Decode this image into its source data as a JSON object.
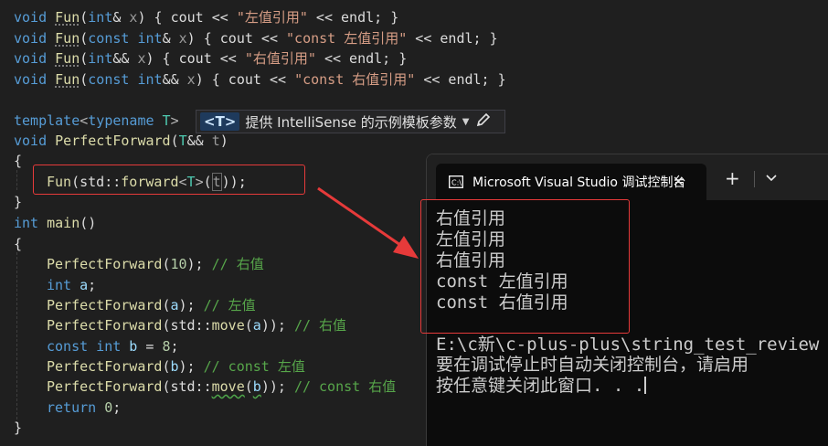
{
  "editor": {
    "lines": {
      "l1": {
        "kw1": "void",
        "fn": "Fun",
        "p1": "(",
        "kw2": "int",
        "op1": "&",
        "pm": " x",
        "rest": ") { cout << ",
        "str": "\"左值引用\"",
        "tail": " << endl; }"
      },
      "l2": {
        "kw1": "void",
        "fn": "Fun",
        "p1": "(",
        "kw2": "const int",
        "op1": "&",
        "pm": " x",
        "rest": ") { cout << ",
        "str": "\"const 左值引用\"",
        "tail": " << endl; }"
      },
      "l3": {
        "kw1": "void",
        "fn": "Fun",
        "p1": "(",
        "kw2": "int",
        "op1": "&&",
        "pm": " x",
        "rest": ") { cout << ",
        "str": "\"右值引用\"",
        "tail": " << endl; }"
      },
      "l4": {
        "kw1": "void",
        "fn": "Fun",
        "p1": "(",
        "kw2": "const int",
        "op1": "&&",
        "pm": " x",
        "rest": ") { cout << ",
        "str": "\"const 右值引用\"",
        "tail": " << endl; }"
      },
      "l6": {
        "kw1": "template",
        "op1": "<",
        "kw2": "typename",
        "tp": " T",
        "op2": ">"
      },
      "l7": {
        "kw1": "void",
        "fn": "PerfectForward",
        "p1": "(",
        "tp": "T",
        "op1": "&&",
        "pm": " t",
        "p2": ")"
      },
      "l8": "{",
      "l9": {
        "fn": "Fun",
        "p1": "(std::",
        "fn2": "forward",
        "op1": "<",
        "tp": "T",
        "op2": ">",
        "p2": "(",
        "pm": "t",
        "p3": "));"
      },
      "l10": "}",
      "l11": {
        "kw1": "int",
        "fn": " main",
        "p1": "()"
      },
      "l12": "{",
      "l13": {
        "fn": "PerfectForward",
        "p1": "(",
        "num": "10",
        "p2": "); ",
        "cm": "// 右值"
      },
      "l14": {
        "kw1": "int",
        "vr": " a",
        "p1": ";"
      },
      "l15": {
        "fn": "PerfectForward",
        "p1": "(",
        "vr": "a",
        "p2": "); ",
        "cm": "// 左值"
      },
      "l16": {
        "fn": "PerfectForward",
        "p1": "(std::",
        "fn2": "move",
        "p2": "(",
        "vr": "a",
        "p3": ")); ",
        "cm": "// 右值"
      },
      "l17": {
        "kw1": "const int",
        "vr": " b",
        "p1": " = ",
        "num": "8",
        "p2": ";"
      },
      "l18": {
        "fn": "PerfectForward",
        "p1": "(",
        "vr": "b",
        "p2": "); ",
        "cm": "// const 左值"
      },
      "l19": {
        "fn": "PerfectForward",
        "p1": "(std::",
        "fn2": "move",
        "p2": "(",
        "vr": "b",
        "p3": ")); ",
        "cm": "// const 右值"
      },
      "l20": {
        "kw1": "return",
        "num": " 0",
        "p1": ";"
      },
      "l21": "}"
    },
    "template_bar": {
      "badge": "<T>",
      "label": "提供 IntelliSense 的示例模板参数"
    }
  },
  "console": {
    "title": "Microsoft Visual Studio 调试控制台",
    "output": [
      "右值引用",
      "左值引用",
      "右值引用",
      "const 左值引用",
      "const 右值引用",
      "",
      "E:\\c新\\c-plus-plus\\string_test_review",
      "要在调试停止时自动关闭控制台，请启用",
      "按任意键关闭此窗口. . ."
    ]
  },
  "colors": {
    "editor_bg": "#1f1f1f",
    "keyword": "#569cd6",
    "function": "#dcdcaa",
    "type": "#4ec9b0",
    "string": "#d69d85",
    "comment": "#57a64a",
    "annotation_red": "#e63a3a",
    "console_bg": "#0c0c0c"
  },
  "icons": {
    "console_icon": "terminal-icon",
    "close": "close-icon",
    "new_tab": "plus-icon",
    "dropdown": "chevron-down-icon",
    "edit": "pencil-icon"
  }
}
